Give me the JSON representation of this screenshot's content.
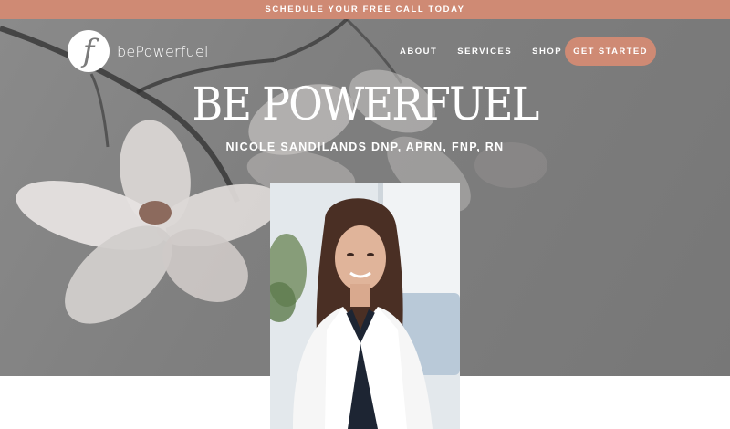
{
  "announcement": {
    "text": "SCHEDULE YOUR FREE CALL TODAY"
  },
  "brand": {
    "logo_letter": "f",
    "name": "bePowerfuel"
  },
  "nav": {
    "items": [
      {
        "label": "ABOUT"
      },
      {
        "label": "SERVICES"
      },
      {
        "label": "SHOP"
      }
    ]
  },
  "cta": {
    "label": "GET STARTED"
  },
  "hero": {
    "title": "BE POWERFUEL",
    "subtitle": "NICOLE SANDILANDS DNP, APRN, FNP, RN"
  },
  "colors": {
    "accent": "#cf8a74",
    "hero_overlay": "#7f7f7f",
    "text": "#ffffff"
  },
  "icons": {
    "logo": "f-logo-icon"
  }
}
